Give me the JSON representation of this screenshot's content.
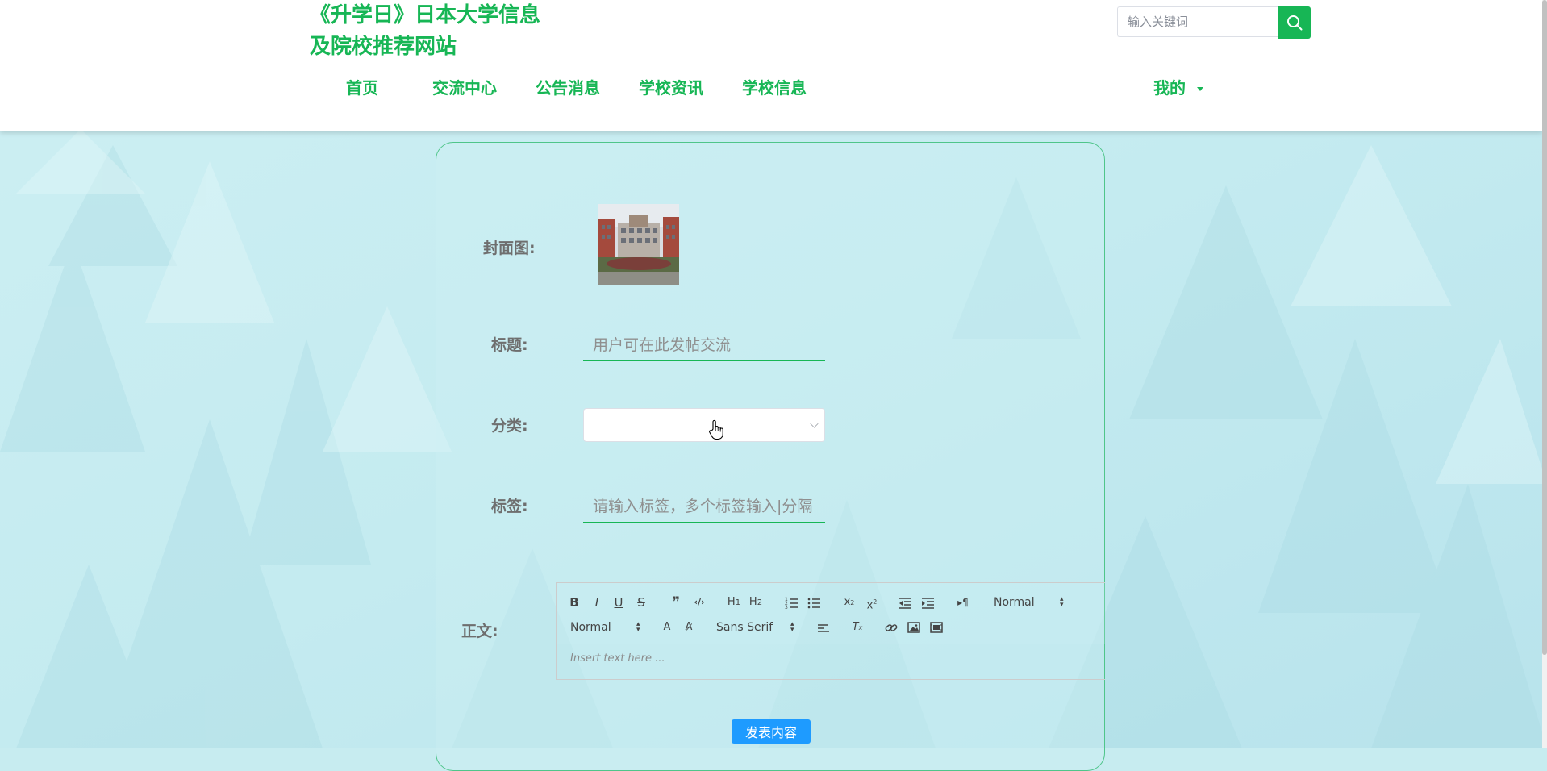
{
  "header": {
    "site_title": "《升学日》日本大学信息及院校推荐网站",
    "search_placeholder": "输入关键词",
    "nav": [
      {
        "label": "首页"
      },
      {
        "label": "交流中心"
      },
      {
        "label": "公告消息"
      },
      {
        "label": "学校资讯"
      },
      {
        "label": "学校信息"
      }
    ],
    "user_menu": "我的"
  },
  "form": {
    "cover_label": "封面图:",
    "title_label": "标题:",
    "title_placeholder": "用户可在此发帖交流",
    "category_label": "分类:",
    "category_value": "",
    "tags_label": "标签:",
    "tags_placeholder": "请输入标签，多个标签输入|分隔",
    "body_label": "正文:",
    "submit_label": "发表内容"
  },
  "editor": {
    "header_select": "Normal",
    "size_select": "Normal",
    "font_select": "Sans Serif",
    "placeholder": "Insert text here ..."
  },
  "colors": {
    "brand_green": "#17b655",
    "submit_blue": "#1e9bff",
    "card_border": "#4fc58a"
  }
}
